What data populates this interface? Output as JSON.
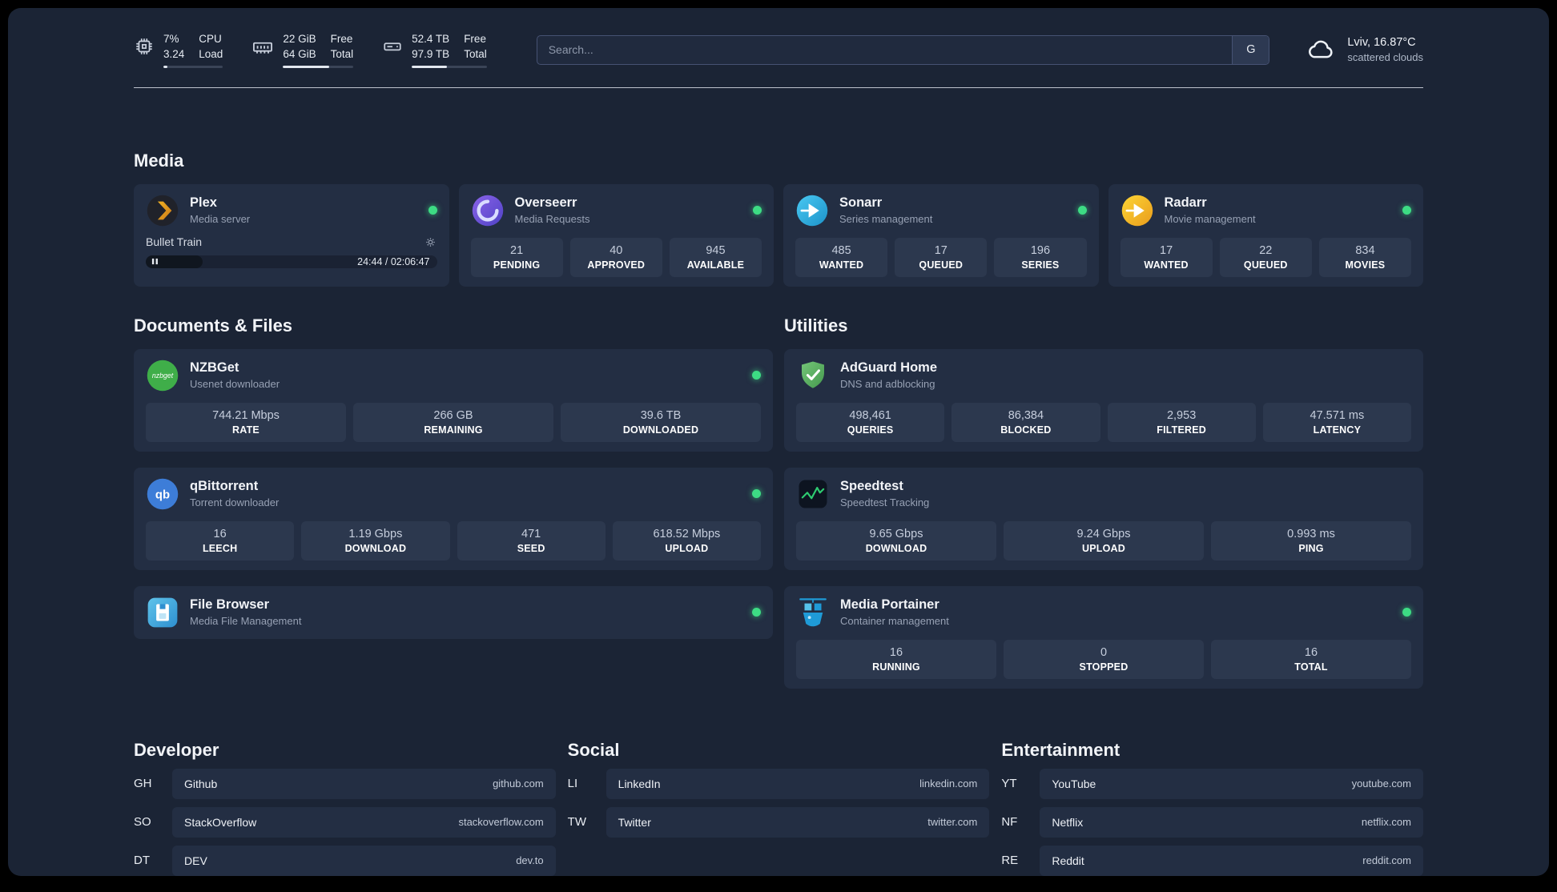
{
  "topbar": {
    "cpu": {
      "percent": "7%",
      "load": "3.24",
      "label_top": "CPU",
      "label_bottom": "Load",
      "bar_fill": "7%"
    },
    "ram": {
      "free": "22 GiB",
      "total": "64 GiB",
      "label_top": "Free",
      "label_bottom": "Total",
      "bar_fill": "66%"
    },
    "disk": {
      "free": "52.4 TB",
      "total": "97.9 TB",
      "label_top": "Free",
      "label_bottom": "Total",
      "bar_fill": "47%"
    },
    "search": {
      "placeholder": "Search...",
      "engine_label": "G"
    },
    "weather": {
      "location": "Lviv, 16.87°C",
      "condition": "scattered clouds"
    }
  },
  "media": {
    "section_title": "Media",
    "plex": {
      "title": "Plex",
      "subtitle": "Media server",
      "now_playing": "Bullet Train",
      "time": "24:44 / 02:06:47",
      "progress": "19.5%"
    },
    "overseerr": {
      "title": "Overseerr",
      "subtitle": "Media Requests",
      "stats": [
        {
          "value": "21",
          "label": "PENDING"
        },
        {
          "value": "40",
          "label": "APPROVED"
        },
        {
          "value": "945",
          "label": "AVAILABLE"
        }
      ]
    },
    "sonarr": {
      "title": "Sonarr",
      "subtitle": "Series management",
      "stats": [
        {
          "value": "485",
          "label": "WANTED"
        },
        {
          "value": "17",
          "label": "QUEUED"
        },
        {
          "value": "196",
          "label": "SERIES"
        }
      ]
    },
    "radarr": {
      "title": "Radarr",
      "subtitle": "Movie management",
      "stats": [
        {
          "value": "17",
          "label": "WANTED"
        },
        {
          "value": "22",
          "label": "QUEUED"
        },
        {
          "value": "834",
          "label": "MOVIES"
        }
      ]
    }
  },
  "documents": {
    "section_title": "Documents & Files",
    "nzbget": {
      "title": "NZBGet",
      "subtitle": "Usenet downloader",
      "stats": [
        {
          "value": "744.21 Mbps",
          "label": "RATE"
        },
        {
          "value": "266 GB",
          "label": "REMAINING"
        },
        {
          "value": "39.6 TB",
          "label": "DOWNLOADED"
        }
      ]
    },
    "qbittorrent": {
      "title": "qBittorrent",
      "subtitle": "Torrent downloader",
      "stats": [
        {
          "value": "16",
          "label": "LEECH"
        },
        {
          "value": "1.19 Gbps",
          "label": "DOWNLOAD"
        },
        {
          "value": "471",
          "label": "SEED"
        },
        {
          "value": "618.52 Mbps",
          "label": "UPLOAD"
        }
      ]
    },
    "filebrowser": {
      "title": "File Browser",
      "subtitle": "Media File Management"
    }
  },
  "utilities": {
    "section_title": "Utilities",
    "adguard": {
      "title": "AdGuard Home",
      "subtitle": "DNS and adblocking",
      "stats": [
        {
          "value": "498,461",
          "label": "QUERIES"
        },
        {
          "value": "86,384",
          "label": "BLOCKED"
        },
        {
          "value": "2,953",
          "label": "FILTERED"
        },
        {
          "value": "47.571 ms",
          "label": "LATENCY"
        }
      ]
    },
    "speedtest": {
      "title": "Speedtest",
      "subtitle": "Speedtest Tracking",
      "stats": [
        {
          "value": "9.65 Gbps",
          "label": "DOWNLOAD"
        },
        {
          "value": "9.24 Gbps",
          "label": "UPLOAD"
        },
        {
          "value": "0.993 ms",
          "label": "PING"
        }
      ]
    },
    "portainer": {
      "title": "Media Portainer",
      "subtitle": "Container management",
      "stats": [
        {
          "value": "16",
          "label": "RUNNING"
        },
        {
          "value": "0",
          "label": "STOPPED"
        },
        {
          "value": "16",
          "label": "TOTAL"
        }
      ]
    }
  },
  "bookmarks": {
    "developer": {
      "section_title": "Developer",
      "items": [
        {
          "abbr": "GH",
          "name": "Github",
          "url": "github.com"
        },
        {
          "abbr": "SO",
          "name": "StackOverflow",
          "url": "stackoverflow.com"
        },
        {
          "abbr": "DT",
          "name": "DEV",
          "url": "dev.to"
        }
      ]
    },
    "social": {
      "section_title": "Social",
      "items": [
        {
          "abbr": "LI",
          "name": "LinkedIn",
          "url": "linkedin.com"
        },
        {
          "abbr": "TW",
          "name": "Twitter",
          "url": "twitter.com"
        }
      ]
    },
    "entertainment": {
      "section_title": "Entertainment",
      "items": [
        {
          "abbr": "YT",
          "name": "YouTube",
          "url": "youtube.com"
        },
        {
          "abbr": "NF",
          "name": "Netflix",
          "url": "netflix.com"
        },
        {
          "abbr": "RE",
          "name": "Reddit",
          "url": "reddit.com"
        }
      ]
    }
  },
  "icons": {
    "nzbget_text": "nzbget",
    "qb_text": "qb"
  },
  "colors": {
    "status_online": "#3ddc84",
    "speedtest_line": "#2ecc71"
  }
}
